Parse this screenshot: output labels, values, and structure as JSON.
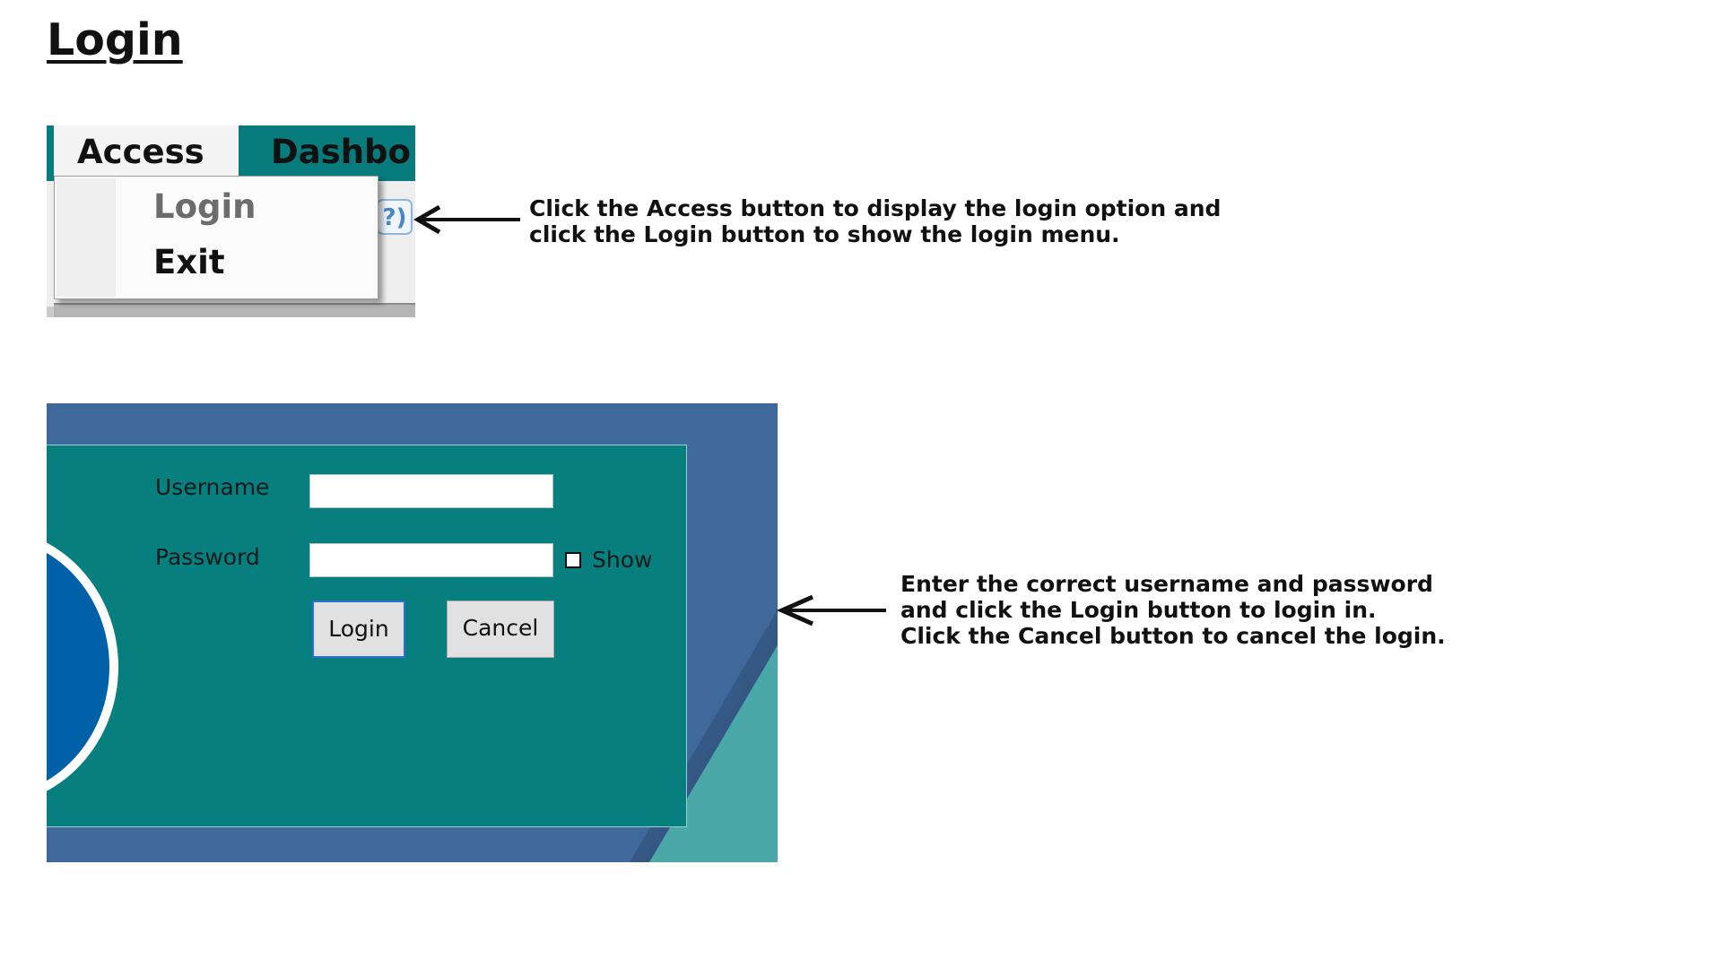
{
  "page": {
    "title": "Login"
  },
  "menu_screenshot": {
    "menubar": {
      "access_label": "Access",
      "dashboard_label": "Dashbo"
    },
    "help_badge": "?)",
    "dropdown": {
      "login_label": "Login",
      "exit_label": "Exit"
    }
  },
  "login_form": {
    "username_label": "Username",
    "password_label": "Password",
    "username_value": "",
    "password_value": "",
    "show_label": "Show",
    "show_checked": false,
    "login_button": "Login",
    "cancel_button": "Cancel"
  },
  "instructions": {
    "step1": "Click the Access button to display the login option and\nclick the Login button to show the login menu.",
    "step2": "Enter the correct username and password\nand click the Login button to login in.\nClick the Cancel button to cancel the login."
  },
  "colors": {
    "teal": "#087f7f",
    "background_blue": "#3f689b",
    "light_teal": "#4aa8a8",
    "logo_blue": "#0060a8",
    "login_button_border": "#2f6ed3"
  },
  "icons": [
    "arrow-left-icon",
    "help-icon",
    "checkbox-icon"
  ]
}
